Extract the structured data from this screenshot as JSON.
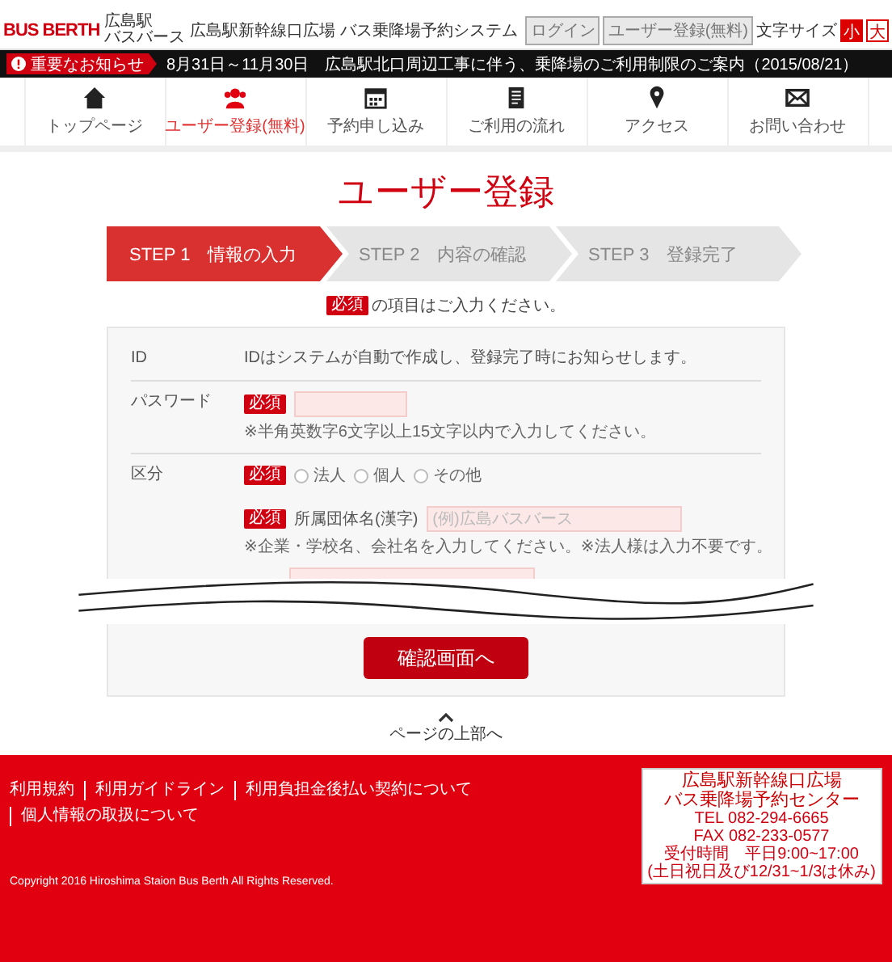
{
  "header": {
    "logo": "BUS BERTH",
    "logo_sub": [
      "広島駅",
      "バスバース"
    ],
    "system_title": "広島駅新幹線口広場 バス乗降場予約システム",
    "buttons": [
      "ログイン",
      "ユーザー登録(無料)"
    ],
    "font_size_label": "文字サイズ",
    "font_sizes": [
      {
        "label": "小",
        "selected": true
      },
      {
        "label": "大",
        "selected": false
      }
    ]
  },
  "notice": {
    "badge": "重要なお知らせ",
    "text": "8月31日～11月30日　広島駅北口周辺工事に伴う、乗降場のご利用制限のご案内（2015/08/21）"
  },
  "nav": [
    {
      "kind": "home",
      "label": "トップページ",
      "selected": false
    },
    {
      "kind": "users",
      "label": "ユーザー登録(無料)",
      "selected": true
    },
    {
      "kind": "calendar",
      "label": "予約申し込み",
      "selected": false
    },
    {
      "kind": "document",
      "label": "ご利用の流れ",
      "selected": false
    },
    {
      "kind": "pin",
      "label": "アクセス",
      "selected": false
    },
    {
      "kind": "mail",
      "label": "お問い合わせ",
      "selected": false
    }
  ],
  "page_title": "ユーザー登録",
  "steps": [
    {
      "label": "STEP 1　情報の入力",
      "selected": true
    },
    {
      "label": "STEP 2　内容の確認",
      "selected": false
    },
    {
      "label": "STEP 3　登録完了",
      "selected": false
    }
  ],
  "required_note": {
    "badge": "必須",
    "text": "の項目はご入力ください。"
  },
  "form": {
    "rows": [
      {
        "kind": "text",
        "label": "ID",
        "value": "IDはシステムが自動で作成し、登録完了時にお知らせします。"
      },
      {
        "kind": "input",
        "label": "パスワード",
        "badge": "必須",
        "hint": "※半角英数字6文字以上15文字以内で入力してください。"
      },
      {
        "kind": "radio",
        "label": "区分",
        "badge": "必須",
        "options": [
          {
            "label": "法人",
            "selected": false
          },
          {
            "label": "個人",
            "selected": false
          },
          {
            "label": "その他",
            "selected": false
          }
        ]
      },
      {
        "kind": "labeled_input",
        "badge": "必須",
        "field_label": "所属団体名(漢字)",
        "placeholder": "(例)広島バスバース",
        "hint": "※企業・学校名、会社名を入力してください。※法人様は入力不要です。"
      },
      {
        "kind": "partial_input"
      }
    ],
    "submit": "確認画面へ"
  },
  "page_top": {
    "label": "ページの上部へ"
  },
  "footer": {
    "links": [
      "利用規約",
      "利用ガイドライン",
      "利用負担金後払い契約について",
      "個人情報の取扱について"
    ],
    "copyright": "Copyright 2016 Hiroshima Staion Bus Berth All Rights Reserved.",
    "contact": [
      "広島駅新幹線口広場",
      "バス乗降場予約センター",
      "TEL 082-294-6665",
      "FAX 082-233-0577",
      "受付時間　平日9:00~17:00",
      "(土日祝日及び12/31~1/3は休み)"
    ]
  }
}
